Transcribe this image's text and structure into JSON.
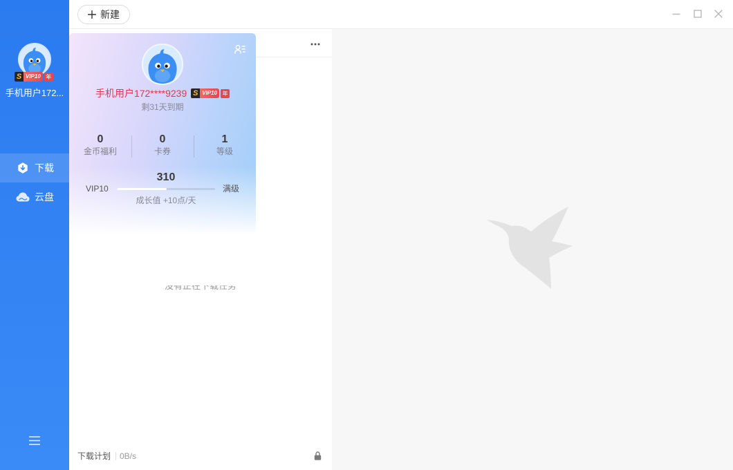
{
  "window": {
    "new_button_label": "新建",
    "controls": [
      "minimize-icon",
      "maximize-icon",
      "close-icon"
    ]
  },
  "sidebar": {
    "user": {
      "name": "手机用户172...",
      "avatar_icon": "bird-avatar-icon",
      "vip_badge": {
        "s": "S",
        "level": "VIP10",
        "year": "年"
      }
    },
    "nav": [
      {
        "label": "下载",
        "icon": "download-icon",
        "active": true
      },
      {
        "label": "云盘",
        "icon": "cloud-icon",
        "active": false
      }
    ],
    "menu_icon": "menu-icon"
  },
  "download_panel": {
    "more_icon": "more-icon",
    "empty_text": "没有正在下载任务",
    "footer": {
      "plan_label": "下载计划",
      "speed": "0B/s",
      "lock_icon": "lock-icon"
    }
  },
  "user_card": {
    "profile_icon": "contact-card-icon",
    "username": "手机用户172****9239",
    "vip_badge": {
      "s": "S",
      "level": "VIP10",
      "year": "年"
    },
    "expiry": "剩31天到期",
    "stats": [
      {
        "value": "0",
        "label": "金币福利"
      },
      {
        "value": "0",
        "label": "卡券"
      },
      {
        "value": "1",
        "label": "等级"
      }
    ],
    "growth": {
      "points": "310",
      "current_level": "VIP10",
      "next_level": "满级",
      "progress": 0.51,
      "rate": "成长值 +10点/天"
    }
  },
  "background_logo_icon": "hummingbird-logo-icon",
  "colors": {
    "sidebar_top": "#2b7bf0",
    "sidebar_bottom": "#3a8af7",
    "username": "#e8344e",
    "vip_red": "#e8454f",
    "vip_s_gold": "#f5c542",
    "content_bg": "#f7f7f7"
  }
}
